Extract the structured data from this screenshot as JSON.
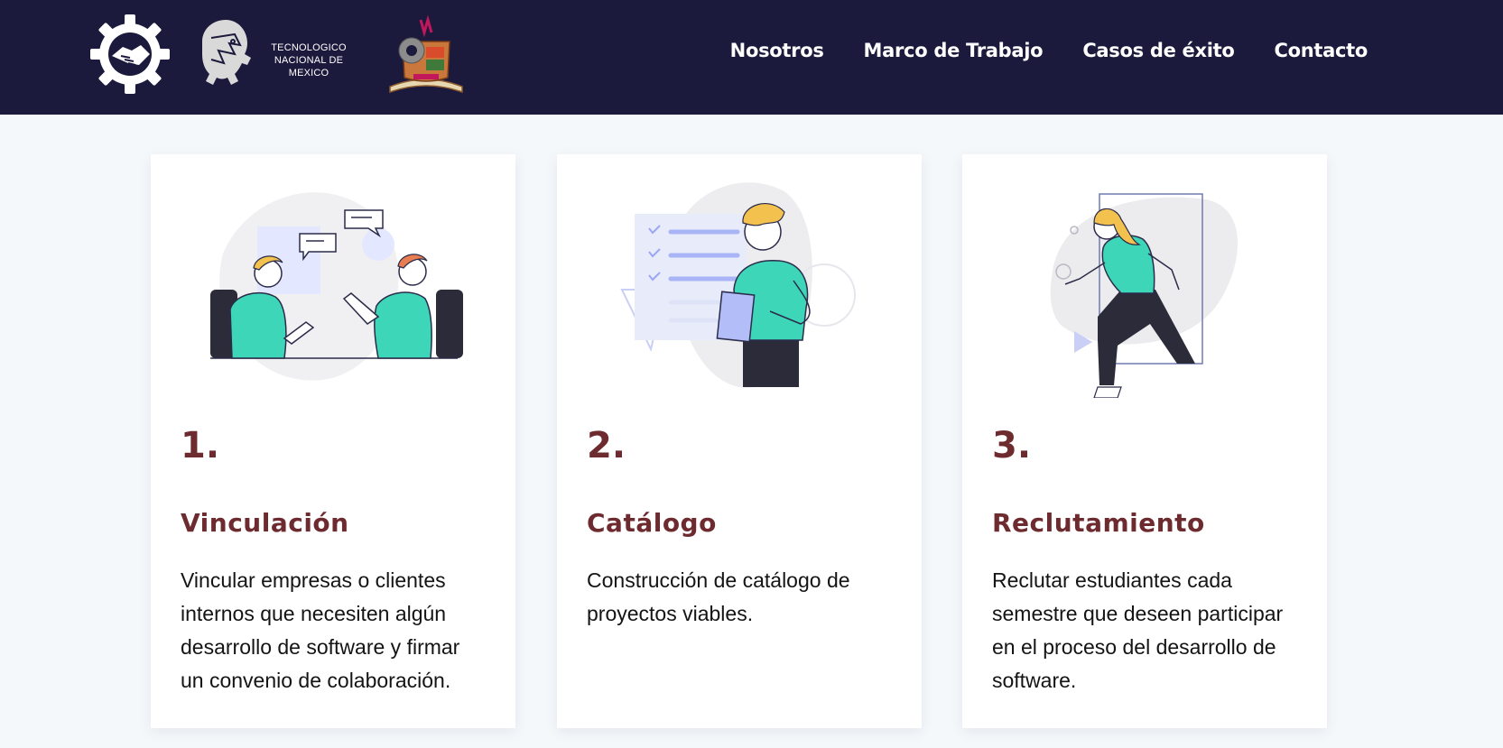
{
  "header": {
    "logos": {
      "gear_logo_icon": "handshake-gear-icon",
      "tecnm_logo_text_line1": "TECNOLOGICO",
      "tecnm_logo_text_line2": "NACIONAL DE MEXICO",
      "crest_logo_icon": "institute-crest-icon"
    },
    "nav": [
      {
        "label": "Nosotros"
      },
      {
        "label": "Marco de Trabajo"
      },
      {
        "label": "Casos de éxito"
      },
      {
        "label": "Contacto"
      }
    ]
  },
  "cards": [
    {
      "number": "1.",
      "title": "Vinculación",
      "text": "Vincular empresas o clientes internos que necesiten algún desarrollo de software y firmar un convenio de colaboración.",
      "illustration": "two-people-talking-illustration"
    },
    {
      "number": "2.",
      "title": "Catálogo",
      "text": "Construcción de catálogo de proyectos viables.",
      "illustration": "person-with-checklist-illustration"
    },
    {
      "number": "3.",
      "title": "Reclutamiento",
      "text": "Reclutar estudiantes cada semestre que deseen participar en el proceso del desarrollo de software.",
      "illustration": "person-stepping-through-door-illustration"
    }
  ],
  "colors": {
    "navbar_bg": "#1c1a3c",
    "accent_maroon": "#6e2b2f",
    "teal_shirt": "#3dd6b8",
    "page_bg": "#f5f8fb"
  }
}
